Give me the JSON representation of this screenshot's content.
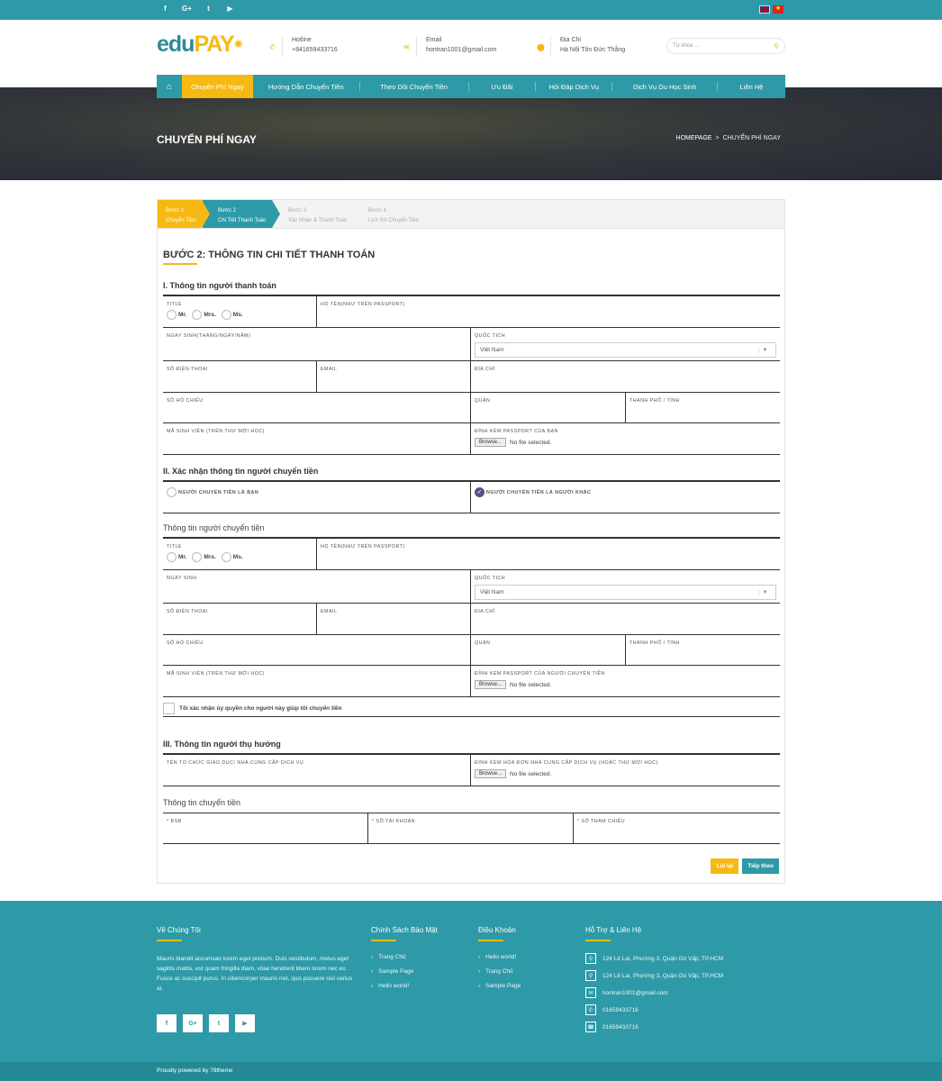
{
  "topbar": {
    "social": [
      "f",
      "G+",
      "t",
      "yt"
    ],
    "flags": [
      "en",
      "vn"
    ]
  },
  "header": {
    "logo_edu": "edu",
    "logo_pay": "PAY",
    "hotline": {
      "title": "Hotline",
      "value": "+841659433716",
      "icon": "phone-icon"
    },
    "email": {
      "title": "Email",
      "value": "hontran1001@gmail.com",
      "icon": "mail-icon"
    },
    "address": {
      "title": "Địa Chỉ",
      "value": "Hà Nội Tôn Đức Thắng",
      "icon": "map-pin-icon"
    },
    "search_placeholder": "Từ khóa ..."
  },
  "nav": {
    "items": [
      "Chuyển Phí Ngay",
      "Hướng Dẫn Chuyển Tiền",
      "Theo Dõi Chuyển Tiền",
      "Ưu Đãi",
      "Hỏi Đáp Dịch Vụ",
      "Dịch Vụ Du Học Sinh",
      "Liên Hệ"
    ],
    "active": 0
  },
  "banner": {
    "title": "CHUYỂN PHÍ NGAY",
    "crumb_home": "HOMEPAGE",
    "crumb_sep": ">",
    "crumb_current": "CHUYỂN PHÍ NGAY"
  },
  "steps": [
    {
      "num": "Bước 1",
      "label": "Chuyển Tiền"
    },
    {
      "num": "Bước 2",
      "label": "Chi Tiết Thanh Toán"
    },
    {
      "num": "Bước 3",
      "label": "Xác Nhận & Thanh Toán"
    },
    {
      "num": "Bước 4",
      "label": "Lịch Sử Chuyển Tiền"
    }
  ],
  "form": {
    "heading": "BƯỚC 2: THÔNG TIN CHI TIẾT THANH TOÁN",
    "sec1": "I. Thông tin người thanh toán",
    "sec2": "II. Xác nhận thông tin người chuyển tiền",
    "sec2_sub": "Thông tin người chuyển tiền",
    "sec3": "III. Thông tin người thụ hưởng",
    "sec3_sub": "Thông tin chuyển tiền",
    "labels": {
      "title": "TITLE",
      "fullname": "HỌ TÊN(NHƯ TRÊN PASSPORT)",
      "dob": "NGÀY SINH(THÁNG/NGÀY/NĂM)",
      "dob2": "NGÀY SINH",
      "nationality": "QUỐC TỊCH",
      "phone": "SỐ ĐIỆN THOẠI",
      "email": "EMAIL",
      "address": "ĐỊA CHỈ",
      "passport": "SỐ HỘ CHIẾU",
      "district": "QUẬN",
      "city": "THÀNH PHỐ / TỈNH",
      "student_id": "MÃ SINH VIÊN (TRÊN THƯ MỜI HỌC)",
      "attach": "ĐÍNH KÈM PASSPORT CỦA BẠN",
      "attach_sender": "ĐÍNH KÈM PASSPORT CỦA NGƯỜI CHUYỂN TIỀN",
      "org": "TÊN TỔ CHỨC GIÁO DỤC/ NHÀ CUNG CẤP DỊCH VỤ",
      "attach_invoice": "ĐÍNH KÈM HÓA ĐƠN NHÀ CUNG CẤP DỊCH VỤ (HOẶC THƯ MỜI HỌC)",
      "bsb": "* BSB",
      "account": "* SỐ TÀI KHOẢN",
      "reference": "* SỐ THAM CHIẾU",
      "sender_you": "NGƯỜI CHUYỂN TIỀN LÀ BẠN",
      "sender_other": "NGƯỜI CHUYỂN TIỀN LÀ NGƯỜI KHÁC"
    },
    "radios": [
      "Mr.",
      "Mrs.",
      "Ms."
    ],
    "nationality_value": "Việt Nam",
    "browse": "Browse...",
    "no_file": "No file selected.",
    "confirm": "Tôi xác nhận ủy quyền cho người này giúp tôi chuyển tiền",
    "back_btn": "Lùi lại",
    "next_btn": "Tiếp theo"
  },
  "footer": {
    "about_title": "Về Chúng Tôi",
    "about_text": "Mauris blandit accumsan lorem eget pretium. Duis vestibulum, metus eget sagittis mattis, est quam fringilla diam, vitae hendrerit libero lorem nec ex. Fusce ac suscipit purus. In ullamcorper mauris nisl, quis posuere nisl varius at.",
    "policy_title": "Chính Sách Bảo Mật",
    "policy_links": [
      "Trang Chủ",
      "Sample Page",
      "Hello world!"
    ],
    "terms_title": "Điều Khoản",
    "terms_links": [
      "Hello world!",
      "Trang Chủ",
      "Sample Page"
    ],
    "support_title": "Hỗ Trợ & Liên Hệ",
    "contacts": [
      "124 Lê Lai, Phường 3, Quận Gò Vấp, TP.HCM",
      "124 Lê Lai, Phường 3, Quận Gò Vấp, TP.HCM",
      "hontran1001@gmail.com",
      "01659433716",
      "01659433716"
    ],
    "copyright": "Proudly powered by 78theme"
  },
  "colors": {
    "teal": "#2e9aa7",
    "yellow": "#f6b913"
  }
}
